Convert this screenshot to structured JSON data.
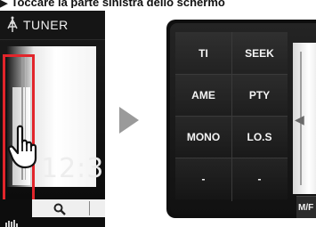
{
  "caption": {
    "arrow": "▶",
    "text": "Toccare la parte sinistra dello schermo"
  },
  "left_screen": {
    "title": "TUNER",
    "clock": "12:3",
    "icons": {
      "tuner": "antenna-icon",
      "hand": "hand-pointer-icon",
      "search": "search-icon",
      "eq": "equalizer-icon"
    }
  },
  "flow": {
    "icon": "right-arrow-icon"
  },
  "right_screen": {
    "buttons": [
      {
        "label": "TI"
      },
      {
        "label": "SEEK"
      },
      {
        "label": "AME"
      },
      {
        "label": "PTY"
      },
      {
        "label": "MONO"
      },
      {
        "label": "LO.S"
      },
      {
        "label": "-"
      },
      {
        "label": "-"
      }
    ],
    "mf_label": "M/F"
  },
  "colors": {
    "highlight": "#e2252b",
    "screen_bg": "#111111",
    "button_text": "#f5f5f5"
  }
}
